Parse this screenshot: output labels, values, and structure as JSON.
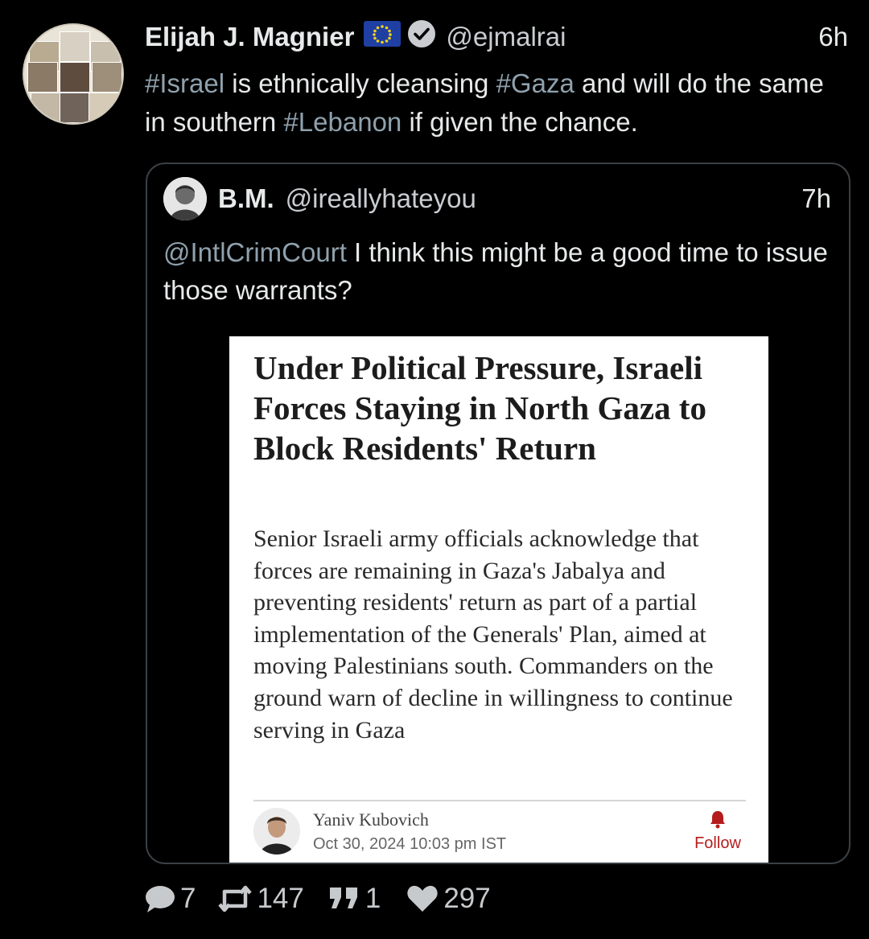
{
  "tweet": {
    "author_name": "Elijah J. Magnier",
    "handle": "@ejmalrai",
    "time": "6h",
    "flag_icon": "eu-flag-icon",
    "badge_icon": "verified-icon",
    "text": {
      "tag1": "#Israel",
      "part1": " is ethnically cleansing ",
      "tag2": "#Gaza",
      "part2": " and will do the same in southern ",
      "tag3": "#Lebanon",
      "part3": " if given the chance."
    },
    "colors": {
      "hashtag": "#8fa1ad",
      "text": "#e7e9ea",
      "background": "#000000"
    }
  },
  "quoted": {
    "author_name": "B.M.",
    "handle": "@ireallyhateyou",
    "time": "7h",
    "mention": "@IntlCrimCourt",
    "text": " I think this might be a good time to issue those warrants?",
    "article": {
      "title": "Under Political Pressure, Israeli Forces Staying in North Gaza to Block Residents' Return",
      "summary": "Senior Israeli army officials acknowledge that forces are remaining in Gaza's Jabalya and preventing residents' return as part of a partial implementation of the Generals' Plan, aimed at moving Palestinians south. Commanders on the ground warn of decline in willingness to continue serving in Gaza",
      "author": "Yaniv Kubovich",
      "date": "Oct 30, 2024 10:03 pm IST",
      "follow_label": "Follow",
      "follow_color": "#b51d1d"
    }
  },
  "actions": {
    "replies": "7",
    "reposts": "147",
    "quotes": "1",
    "likes": "297",
    "icons": [
      "reply-icon",
      "repost-icon",
      "quote-icon",
      "like-icon"
    ]
  }
}
